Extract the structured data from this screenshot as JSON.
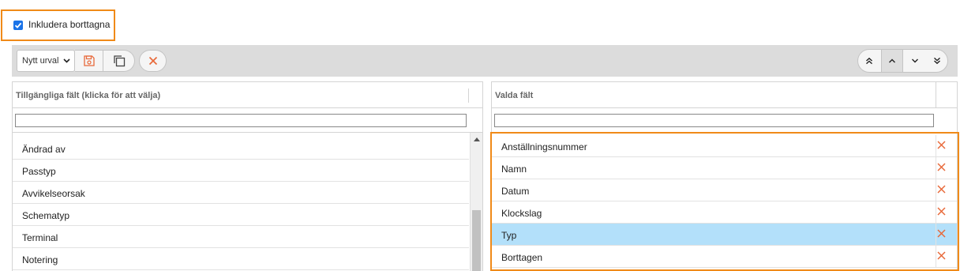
{
  "include_deleted": {
    "label": "Inkludera borttagna",
    "checked": true
  },
  "toolbar": {
    "selection_value": "Nytt urval"
  },
  "available_fields": {
    "header": "Tillgängliga fält (klicka för att välja)",
    "filter_value": "",
    "items": [
      "Ändrad av",
      "Passtyp",
      "Avvikelseorsak",
      "Schematyp",
      "Terminal",
      "Notering"
    ]
  },
  "selected_fields": {
    "header": "Valda fält",
    "filter_value": "",
    "items": [
      {
        "label": "Anställningsnummer",
        "selected": false
      },
      {
        "label": "Namn",
        "selected": false
      },
      {
        "label": "Datum",
        "selected": false
      },
      {
        "label": "Klockslag",
        "selected": false
      },
      {
        "label": "Typ",
        "selected": true
      },
      {
        "label": "Borttagen",
        "selected": false
      }
    ]
  },
  "colors": {
    "accent_orange": "#f08a18",
    "checkbox_blue": "#1a73e8",
    "selected_row": "#b3e0fa",
    "remove_icon": "#e8693a"
  }
}
